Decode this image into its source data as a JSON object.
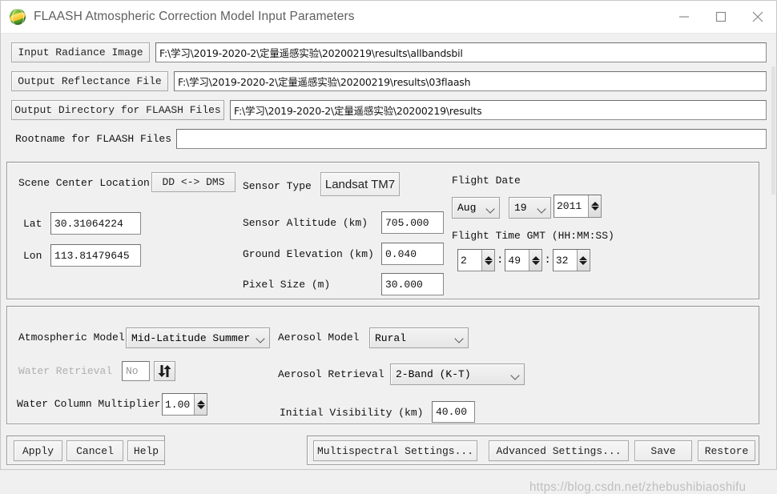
{
  "window": {
    "title": "FLAASH Atmospheric Correction Model Input Parameters",
    "app_icon": "envi-globe-icon",
    "minimize": "minimize-icon",
    "maximize": "maximize-icon",
    "close": "close-icon"
  },
  "files": {
    "input_radiance_label": "Input Radiance Image",
    "input_radiance_value": "F:\\学习\\2019-2020-2\\定量遥感实验\\20200219\\results\\allbandsbil",
    "output_reflectance_label": "Output Reflectance File",
    "output_reflectance_value": "F:\\学习\\2019-2020-2\\定量遥感实验\\20200219\\results\\03flaash",
    "output_directory_label": "Output Directory for FLAASH Files",
    "output_directory_value": "F:\\学习\\2019-2020-2\\定量遥感实验\\20200219\\results",
    "rootname_label": "Rootname for FLAASH Files",
    "rootname_value": ""
  },
  "scene": {
    "center_location_label": "Scene Center Location",
    "dd_dms_button": "DD <-> DMS",
    "lat_label": "Lat",
    "lat_value": "30.31064224",
    "lon_label": "Lon",
    "lon_value": "113.81479645",
    "sensor_type_label": "Sensor Type",
    "sensor_type_value": "Landsat TM7",
    "sensor_altitude_label": "Sensor Altitude (km)",
    "sensor_altitude_value": "705.000",
    "ground_elevation_label": "Ground Elevation (km)",
    "ground_elevation_value": "0.040",
    "pixel_size_label": "Pixel Size (m)",
    "pixel_size_value": "30.000",
    "flight_date_label": "Flight Date",
    "flight_month": "Aug",
    "flight_day": "19",
    "flight_year": "2011",
    "flight_time_label": "Flight Time GMT (HH:MM:SS)",
    "flight_hour": "2",
    "flight_minute": "49",
    "flight_second": "32",
    "time_sep": ":"
  },
  "atmosphere": {
    "atmospheric_model_label": "Atmospheric Model",
    "atmospheric_model_value": "Mid-Latitude Summer",
    "water_retrieval_label": "Water Retrieval",
    "water_retrieval_value": "No",
    "water_retrieval_toggle": "updown-arrows-icon",
    "water_column_label": "Water Column Multiplier",
    "water_column_value": "1.00",
    "aerosol_model_label": "Aerosol Model",
    "aerosol_model_value": "Rural",
    "aerosol_retrieval_label": "Aerosol Retrieval",
    "aerosol_retrieval_value": "2-Band (K-T)",
    "initial_visibility_label": "Initial Visibility (km)",
    "initial_visibility_value": "40.00"
  },
  "footer": {
    "apply": "Apply",
    "cancel": "Cancel",
    "help": "Help",
    "multispectral_settings": "Multispectral Settings...",
    "advanced_settings": "Advanced Settings...",
    "save": "Save",
    "restore": "Restore"
  },
  "watermark": "https://blog.csdn.net/zhebushibiaoshifu"
}
